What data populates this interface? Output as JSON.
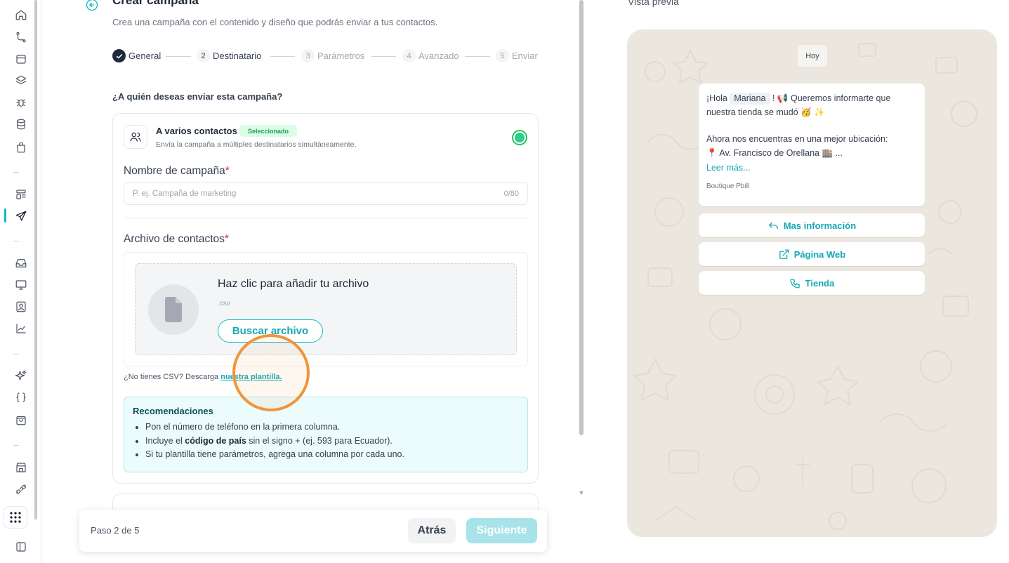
{
  "page": {
    "title": "Crear campaña",
    "subtitle": "Crea una campaña con el contenido y diseño que podrás enviar a tus contactos."
  },
  "steps": [
    {
      "num": "",
      "label": "General"
    },
    {
      "num": "2",
      "label": "Destinatario"
    },
    {
      "num": "3",
      "label": "Parámetros"
    },
    {
      "num": "4",
      "label": "Avanzado"
    },
    {
      "num": "5",
      "label": "Enviar"
    }
  ],
  "question": "¿A quién deseas enviar esta campaña?",
  "option": {
    "title": "A varios contactos",
    "badge": "Seleccionado",
    "description": "Envía la campaña a múltiples destinatarios simultáneamente."
  },
  "campaign_name": {
    "label": "Nombre de campaña",
    "required_mark": "*",
    "placeholder": "P. ej. Campaña de marketing",
    "counter": "0/80"
  },
  "contacts_file": {
    "label": "Archivo de contactos",
    "required_mark": "*",
    "upload_title": "Haz clic para añadir tu archivo",
    "extension": ".csv",
    "browse_label": "Buscar archivo",
    "hint_text": "¿No tienes CSV? Descarga ",
    "hint_link": "nuestra plantilla."
  },
  "recommendations": {
    "title": "Recomendaciones",
    "item1": "Pon el número de teléfono en la primera columna.",
    "item2_pre": "Incluye el ",
    "item2_bold": "código de país",
    "item2_post": " sin el signo + (ej. 593 para Ecuador).",
    "item3": "Si tu plantilla tiene parámetros, agrega una columna por cada uno."
  },
  "footer": {
    "step_text": "Paso 2 de 5",
    "back_label": "Atrás",
    "next_label": "Siguiente"
  },
  "preview": {
    "label": "Vista previa",
    "day": "Hoy",
    "greeting_pre": "¡Hola ",
    "contact_name": "Mariana",
    "greeting_post": " ! 📢 Queremos informarte que nuestra tienda se mudó 🥳 ✨",
    "line2": "Ahora nos encuentras en una mejor ubicación:",
    "line3": "📍 Av. Francisco de Orellana 🏬 ...",
    "read_more": "Leer más...",
    "brand": "Boutique Pbill",
    "buttons": [
      {
        "label": "Mas información",
        "icon": "reply-icon"
      },
      {
        "label": "Página Web",
        "icon": "external-link-icon"
      },
      {
        "label": "Tienda",
        "icon": "phone-icon"
      }
    ]
  },
  "colors": {
    "accent": "#14b8c4",
    "selected_badge_bg": "#dcfce7",
    "radio_green": "#2ecc8f",
    "cursor_highlight": "#f0953a",
    "preview_bg": "#ebe7df"
  }
}
